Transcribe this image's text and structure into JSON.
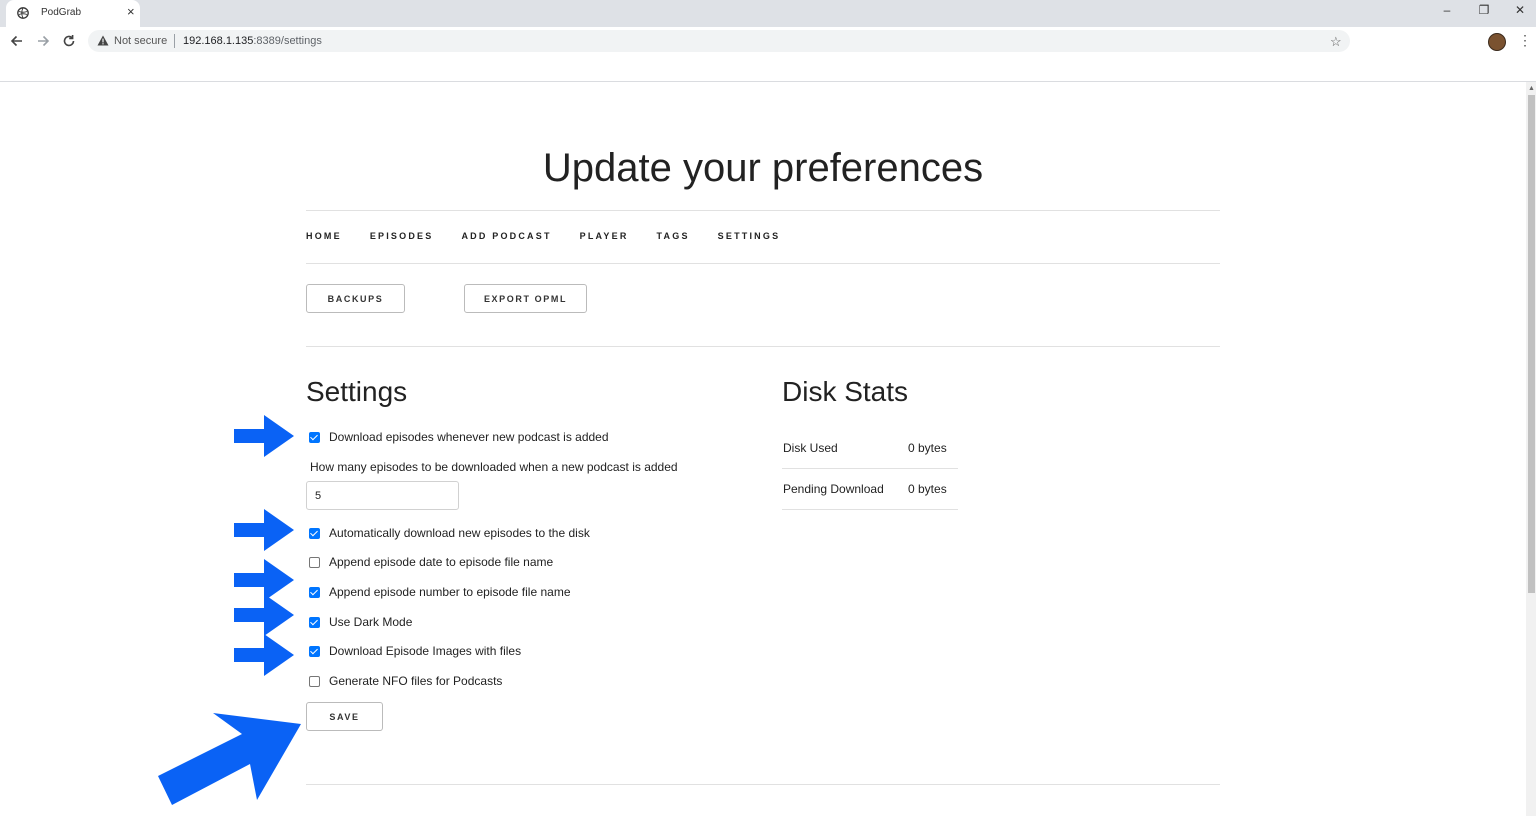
{
  "browser": {
    "tab_title": "PodGrab",
    "tab_close": "×",
    "security_label": "Not secure",
    "url_host": "192.168.1.135",
    "url_rest": ":8389/settings"
  },
  "page": {
    "title": "Update your preferences",
    "nav": [
      "HOME",
      "EPISODES",
      "ADD PODCAST",
      "PLAYER",
      "TAGS",
      "SETTINGS"
    ],
    "backups_label": "BACKUPS",
    "export_label": "EXPORT OPML"
  },
  "settings": {
    "heading": "Settings",
    "opt_download_on_add": {
      "label": "Download episodes whenever new podcast is added",
      "checked": true
    },
    "episodes_on_add_label": "How many episodes to be downloaded when a new podcast is added",
    "episodes_on_add_value": "5",
    "opt_auto_download": {
      "label": "Automatically download new episodes to the disk",
      "checked": true
    },
    "opt_append_date": {
      "label": "Append episode date to episode file name",
      "checked": false
    },
    "opt_append_number": {
      "label": "Append episode number to episode file name",
      "checked": true
    },
    "opt_dark_mode": {
      "label": "Use Dark Mode",
      "checked": true
    },
    "opt_download_images": {
      "label": "Download Episode Images with files",
      "checked": true
    },
    "opt_generate_nfo": {
      "label": "Generate NFO files for Podcasts",
      "checked": false
    },
    "save_label": "SAVE"
  },
  "disk_stats": {
    "heading": "Disk Stats",
    "rows": [
      {
        "label": "Disk Used",
        "value": "0 bytes"
      },
      {
        "label": "Pending Download",
        "value": "0 bytes"
      }
    ]
  },
  "colors": {
    "annotation_arrow": "#0a62f5",
    "checkbox_accent": "#0075ff"
  },
  "icons": [
    "site-favicon-icon",
    "back-icon",
    "forward-icon",
    "reload-icon",
    "warning-icon",
    "star-icon",
    "kebab-menu-icon"
  ]
}
